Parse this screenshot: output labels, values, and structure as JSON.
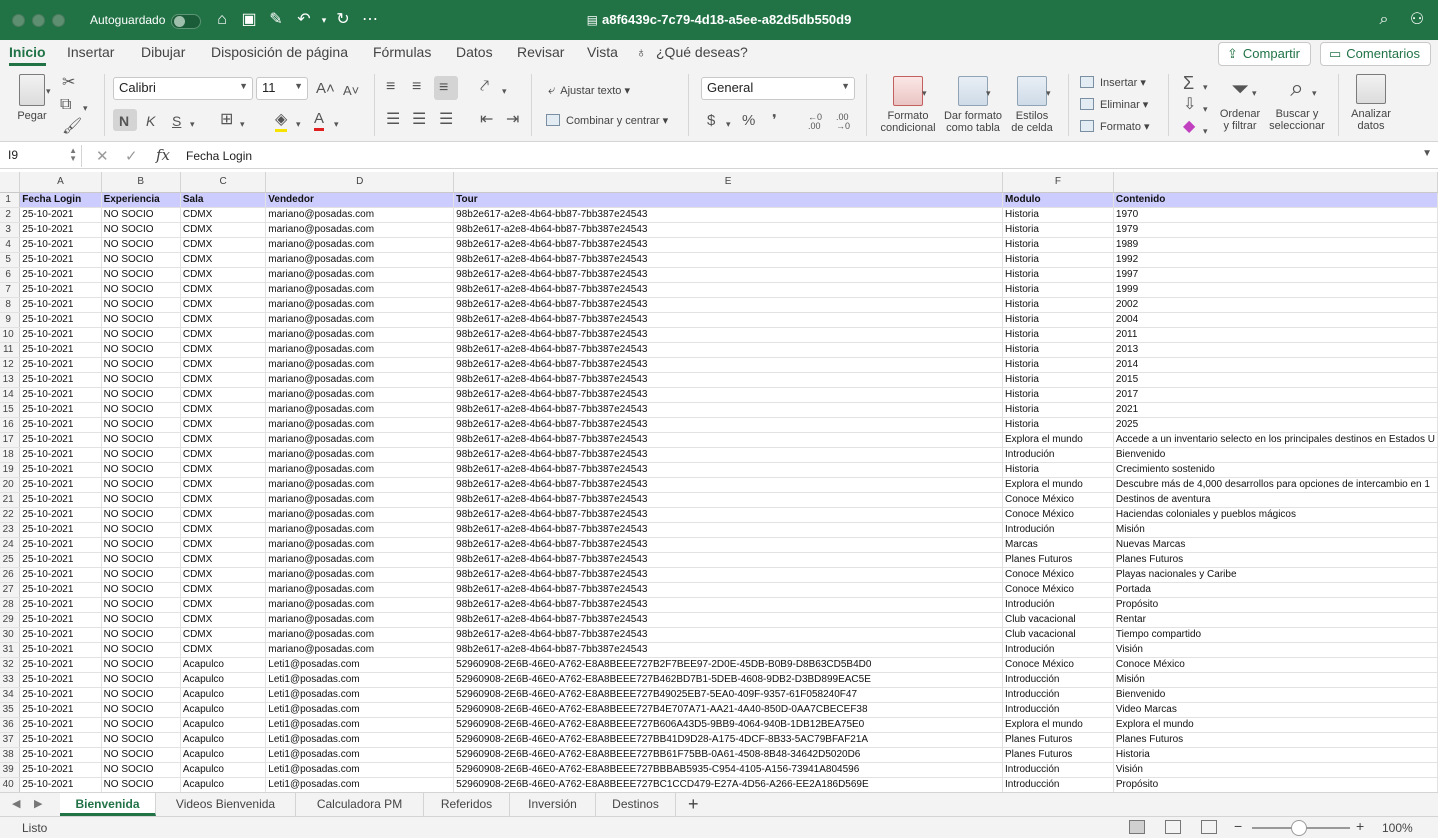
{
  "titlebar": {
    "autosave_label": "Autoguardado",
    "doc_title": "a8f6439c-7c79-4d18-a5ee-a82d5db550d9",
    "bg_color": "#217346"
  },
  "menu": {
    "tabs": [
      "Inicio",
      "Insertar",
      "Dibujar",
      "Disposición de página",
      "Fórmulas",
      "Datos",
      "Revisar",
      "Vista"
    ],
    "tell_me": "¿Qué deseas?",
    "share": "Compartir",
    "comments": "Comentarios"
  },
  "ribbon": {
    "paste": "Pegar",
    "font_name": "Calibri",
    "font_size": "11",
    "bold": "N",
    "italic": "K",
    "underline": "S",
    "wrap_text": "Ajustar texto",
    "merge_center": "Combinar y centrar",
    "number_format": "General",
    "conditional_format": [
      "Formato",
      "condicional"
    ],
    "format_as_table": [
      "Dar formato",
      "como tabla"
    ],
    "cell_styles": [
      "Estilos",
      "de celda"
    ],
    "insert": "Insertar",
    "delete": "Eliminar",
    "format": "Formato",
    "sort_filter": [
      "Ordenar",
      "y filtrar"
    ],
    "find_select": [
      "Buscar y",
      "seleccionar"
    ],
    "analyze_data": [
      "Analizar",
      "datos"
    ],
    "currency": "$",
    "percent": "%",
    "comma": "❜",
    "dec_increase": "←0 .00",
    "dec_decrease": ".00 →0"
  },
  "formula_bar": {
    "name_box": "I9",
    "fx": "fx",
    "content": "Fecha Login"
  },
  "sheet": {
    "column_letters": [
      "A",
      "B",
      "C",
      "D",
      "E",
      "F",
      ""
    ],
    "header_row": [
      "Fecha Login",
      "Experiencia",
      "Sala",
      "Vendedor",
      "Tour",
      "Modulo",
      "Contenido"
    ],
    "rows": [
      [
        "25-10-2021",
        "NO SOCIO",
        "CDMX",
        "mariano@posadas.com",
        "98b2e617-a2e8-4b64-bb87-7bb387e24543",
        "Historia",
        "1970"
      ],
      [
        "25-10-2021",
        "NO SOCIO",
        "CDMX",
        "mariano@posadas.com",
        "98b2e617-a2e8-4b64-bb87-7bb387e24543",
        "Historia",
        "1979"
      ],
      [
        "25-10-2021",
        "NO SOCIO",
        "CDMX",
        "mariano@posadas.com",
        "98b2e617-a2e8-4b64-bb87-7bb387e24543",
        "Historia",
        "1989"
      ],
      [
        "25-10-2021",
        "NO SOCIO",
        "CDMX",
        "mariano@posadas.com",
        "98b2e617-a2e8-4b64-bb87-7bb387e24543",
        "Historia",
        "1992"
      ],
      [
        "25-10-2021",
        "NO SOCIO",
        "CDMX",
        "mariano@posadas.com",
        "98b2e617-a2e8-4b64-bb87-7bb387e24543",
        "Historia",
        "1997"
      ],
      [
        "25-10-2021",
        "NO SOCIO",
        "CDMX",
        "mariano@posadas.com",
        "98b2e617-a2e8-4b64-bb87-7bb387e24543",
        "Historia",
        "1999"
      ],
      [
        "25-10-2021",
        "NO SOCIO",
        "CDMX",
        "mariano@posadas.com",
        "98b2e617-a2e8-4b64-bb87-7bb387e24543",
        "Historia",
        "2002"
      ],
      [
        "25-10-2021",
        "NO SOCIO",
        "CDMX",
        "mariano@posadas.com",
        "98b2e617-a2e8-4b64-bb87-7bb387e24543",
        "Historia",
        "2004"
      ],
      [
        "25-10-2021",
        "NO SOCIO",
        "CDMX",
        "mariano@posadas.com",
        "98b2e617-a2e8-4b64-bb87-7bb387e24543",
        "Historia",
        "2011"
      ],
      [
        "25-10-2021",
        "NO SOCIO",
        "CDMX",
        "mariano@posadas.com",
        "98b2e617-a2e8-4b64-bb87-7bb387e24543",
        "Historia",
        "2013"
      ],
      [
        "25-10-2021",
        "NO SOCIO",
        "CDMX",
        "mariano@posadas.com",
        "98b2e617-a2e8-4b64-bb87-7bb387e24543",
        "Historia",
        "2014"
      ],
      [
        "25-10-2021",
        "NO SOCIO",
        "CDMX",
        "mariano@posadas.com",
        "98b2e617-a2e8-4b64-bb87-7bb387e24543",
        "Historia",
        "2015"
      ],
      [
        "25-10-2021",
        "NO SOCIO",
        "CDMX",
        "mariano@posadas.com",
        "98b2e617-a2e8-4b64-bb87-7bb387e24543",
        "Historia",
        "2017"
      ],
      [
        "25-10-2021",
        "NO SOCIO",
        "CDMX",
        "mariano@posadas.com",
        "98b2e617-a2e8-4b64-bb87-7bb387e24543",
        "Historia",
        "2021"
      ],
      [
        "25-10-2021",
        "NO SOCIO",
        "CDMX",
        "mariano@posadas.com",
        "98b2e617-a2e8-4b64-bb87-7bb387e24543",
        "Historia",
        "2025"
      ],
      [
        "25-10-2021",
        "NO SOCIO",
        "CDMX",
        "mariano@posadas.com",
        "98b2e617-a2e8-4b64-bb87-7bb387e24543",
        "Explora el mundo",
        "Accede a un inventario selecto en los principales destinos en Estados U"
      ],
      [
        "25-10-2021",
        "NO SOCIO",
        "CDMX",
        "mariano@posadas.com",
        "98b2e617-a2e8-4b64-bb87-7bb387e24543",
        "Introdución",
        "Bienvenido"
      ],
      [
        "25-10-2021",
        "NO SOCIO",
        "CDMX",
        "mariano@posadas.com",
        "98b2e617-a2e8-4b64-bb87-7bb387e24543",
        "Historia",
        "Crecimiento sostenido"
      ],
      [
        "25-10-2021",
        "NO SOCIO",
        "CDMX",
        "mariano@posadas.com",
        "98b2e617-a2e8-4b64-bb87-7bb387e24543",
        "Explora el mundo",
        "Descubre más de 4,000 desarrollos para opciones de intercambio en 1"
      ],
      [
        "25-10-2021",
        "NO SOCIO",
        "CDMX",
        "mariano@posadas.com",
        "98b2e617-a2e8-4b64-bb87-7bb387e24543",
        "Conoce México",
        "Destinos de aventura"
      ],
      [
        "25-10-2021",
        "NO SOCIO",
        "CDMX",
        "mariano@posadas.com",
        "98b2e617-a2e8-4b64-bb87-7bb387e24543",
        "Conoce México",
        "Haciendas coloniales y pueblos mágicos"
      ],
      [
        "25-10-2021",
        "NO SOCIO",
        "CDMX",
        "mariano@posadas.com",
        "98b2e617-a2e8-4b64-bb87-7bb387e24543",
        "Introdución",
        "Misión"
      ],
      [
        "25-10-2021",
        "NO SOCIO",
        "CDMX",
        "mariano@posadas.com",
        "98b2e617-a2e8-4b64-bb87-7bb387e24543",
        "Marcas",
        "Nuevas Marcas"
      ],
      [
        "25-10-2021",
        "NO SOCIO",
        "CDMX",
        "mariano@posadas.com",
        "98b2e617-a2e8-4b64-bb87-7bb387e24543",
        "Planes Futuros",
        "Planes Futuros"
      ],
      [
        "25-10-2021",
        "NO SOCIO",
        "CDMX",
        "mariano@posadas.com",
        "98b2e617-a2e8-4b64-bb87-7bb387e24543",
        "Conoce México",
        "Playas nacionales y Caribe"
      ],
      [
        "25-10-2021",
        "NO SOCIO",
        "CDMX",
        "mariano@posadas.com",
        "98b2e617-a2e8-4b64-bb87-7bb387e24543",
        "Conoce México",
        "Portada"
      ],
      [
        "25-10-2021",
        "NO SOCIO",
        "CDMX",
        "mariano@posadas.com",
        "98b2e617-a2e8-4b64-bb87-7bb387e24543",
        "Introdución",
        "Propósito"
      ],
      [
        "25-10-2021",
        "NO SOCIO",
        "CDMX",
        "mariano@posadas.com",
        "98b2e617-a2e8-4b64-bb87-7bb387e24543",
        "Club vacacional",
        "Rentar"
      ],
      [
        "25-10-2021",
        "NO SOCIO",
        "CDMX",
        "mariano@posadas.com",
        "98b2e617-a2e8-4b64-bb87-7bb387e24543",
        "Club vacacional",
        "Tiempo compartido"
      ],
      [
        "25-10-2021",
        "NO SOCIO",
        "CDMX",
        "mariano@posadas.com",
        "98b2e617-a2e8-4b64-bb87-7bb387e24543",
        "Introdución",
        "Visión"
      ],
      [
        "25-10-2021",
        "NO SOCIO",
        "Acapulco",
        "Leti1@posadas.com",
        "52960908-2E6B-46E0-A762-E8A8BEEE727B2F7BEE97-2D0E-45DB-B0B9-D8B63CD5B4D0",
        "Conoce México",
        "Conoce México"
      ],
      [
        "25-10-2021",
        "NO SOCIO",
        "Acapulco",
        "Leti1@posadas.com",
        "52960908-2E6B-46E0-A762-E8A8BEEE727B462BD7B1-5DEB-4608-9DB2-D3BD899EAC5E",
        "Introducción",
        "Misión"
      ],
      [
        "25-10-2021",
        "NO SOCIO",
        "Acapulco",
        "Leti1@posadas.com",
        "52960908-2E6B-46E0-A762-E8A8BEEE727B49025EB7-5EA0-409F-9357-61F058240F47",
        "Introducción",
        "Bienvenido"
      ],
      [
        "25-10-2021",
        "NO SOCIO",
        "Acapulco",
        "Leti1@posadas.com",
        "52960908-2E6B-46E0-A762-E8A8BEEE727B4E707A71-AA21-4A40-850D-0AA7CBECEF38",
        "Introducción",
        "Video Marcas"
      ],
      [
        "25-10-2021",
        "NO SOCIO",
        "Acapulco",
        "Leti1@posadas.com",
        "52960908-2E6B-46E0-A762-E8A8BEEE727B606A43D5-9BB9-4064-940B-1DB12BEA75E0",
        "Explora el mundo",
        "Explora el mundo"
      ],
      [
        "25-10-2021",
        "NO SOCIO",
        "Acapulco",
        "Leti1@posadas.com",
        "52960908-2E6B-46E0-A762-E8A8BEEE727BB41D9D28-A175-4DCF-8B33-5AC79BFAF21A",
        "Planes Futuros",
        "Planes Futuros"
      ],
      [
        "25-10-2021",
        "NO SOCIO",
        "Acapulco",
        "Leti1@posadas.com",
        "52960908-2E6B-46E0-A762-E8A8BEEE727BB61F75BB-0A61-4508-8B48-34642D5020D6",
        "Planes Futuros",
        "Historia"
      ],
      [
        "25-10-2021",
        "NO SOCIO",
        "Acapulco",
        "Leti1@posadas.com",
        "52960908-2E6B-46E0-A762-E8A8BEEE727BBBAB5935-C954-4105-A156-73941A804596",
        "Introducción",
        "Visión"
      ],
      [
        "25-10-2021",
        "NO SOCIO",
        "Acapulco",
        "Leti1@posadas.com",
        "52960908-2E6B-46E0-A762-E8A8BEEE727BC1CCD479-E27A-4D56-A266-EE2A186D569E",
        "Introducción",
        "Propósito"
      ]
    ]
  },
  "sheet_tabs": [
    "Bienvenida",
    "Videos Bienvenida",
    "Calculadora PM",
    "Referidos",
    "Inversión",
    "Destinos"
  ],
  "status": {
    "text": "Listo",
    "zoom": "100%"
  }
}
